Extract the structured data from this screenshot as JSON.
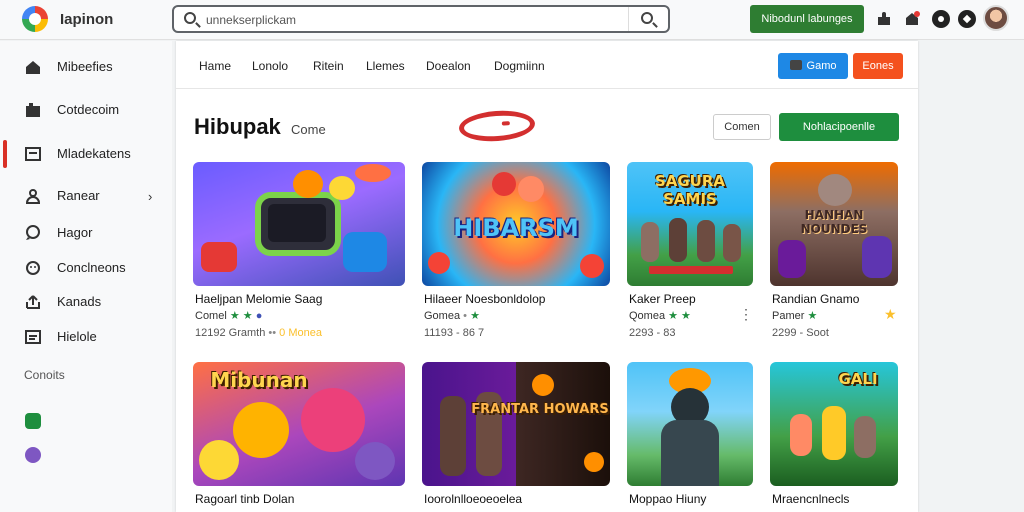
{
  "app": {
    "title": "Iapinon",
    "logo_icon": "app-logo-icon"
  },
  "search": {
    "placeholder": "unnekserplickam"
  },
  "topbar": {
    "cta_label": "Nibodunl labunges",
    "cta_color": "#2e7d32"
  },
  "sidebar": {
    "items": [
      {
        "label": "Mibeefies",
        "icon": "home-icon"
      },
      {
        "label": "Cotdecoim",
        "icon": "library-icon"
      },
      {
        "label": "Mladekatens",
        "icon": "square-icon",
        "active": true
      },
      {
        "label": "Ranear",
        "icon": "person-icon",
        "has_chevron": true
      },
      {
        "label": "Hagor",
        "icon": "chat-icon"
      },
      {
        "label": "Conclneons",
        "icon": "gamepad-icon"
      },
      {
        "label": "Kanads",
        "icon": "upload-icon"
      },
      {
        "label": "Hielole",
        "icon": "list-icon"
      }
    ],
    "section_label": "Conoits",
    "active_color": "#d93025"
  },
  "tabs": [
    "Hame",
    "Lonolo",
    "Ritein",
    "Llemes",
    "Doealon",
    "Dogmiinn"
  ],
  "tab_buttons": [
    {
      "label": "Gamo",
      "color": "#1e88e5"
    },
    {
      "label": "Eones",
      "color": "#f4511e"
    }
  ],
  "page": {
    "title": "Hibupak",
    "subtitle": "Come",
    "outline_button": "Comen",
    "primary_button": "Nohlacipoenlle",
    "primary_color": "#1e8e3e"
  },
  "cards": [
    {
      "title": "Haeljpan Melomie Saag",
      "sub": "Comel",
      "meta": "12192 Gramth",
      "meta_extra": "0 Monea",
      "thumb_text": ""
    },
    {
      "title": "Hilaeer Noesbonldolop",
      "sub": "Gomea",
      "meta": "11193 - 86 7",
      "meta_extra": "",
      "thumb_text": "HIBARSM"
    },
    {
      "title": "Kaker Preep",
      "sub": "Qomea",
      "meta": "2293 - 83",
      "meta_extra": "",
      "thumb_text": "SAGURA SAMIS"
    },
    {
      "title": "Randian Gnamo",
      "sub": "Pamer",
      "meta": "2299 - Soot",
      "meta_extra": "",
      "thumb_text": "HANHAN NOUNDES"
    },
    {
      "title": "Ragoarl tinb Dolan",
      "sub": "",
      "meta": "",
      "meta_extra": "",
      "thumb_text": "Mibunan"
    },
    {
      "title": "Ioorolnlloeoeoelea",
      "sub": "",
      "meta": "",
      "meta_extra": "",
      "thumb_text": "FRANTAR HOWARS"
    },
    {
      "title": "Moppao Hiuny",
      "sub": "",
      "meta": "",
      "meta_extra": "",
      "thumb_text": ""
    },
    {
      "title": "Mraencnlnecls",
      "sub": "",
      "meta": "",
      "meta_extra": "",
      "thumb_text": "GALI"
    }
  ]
}
